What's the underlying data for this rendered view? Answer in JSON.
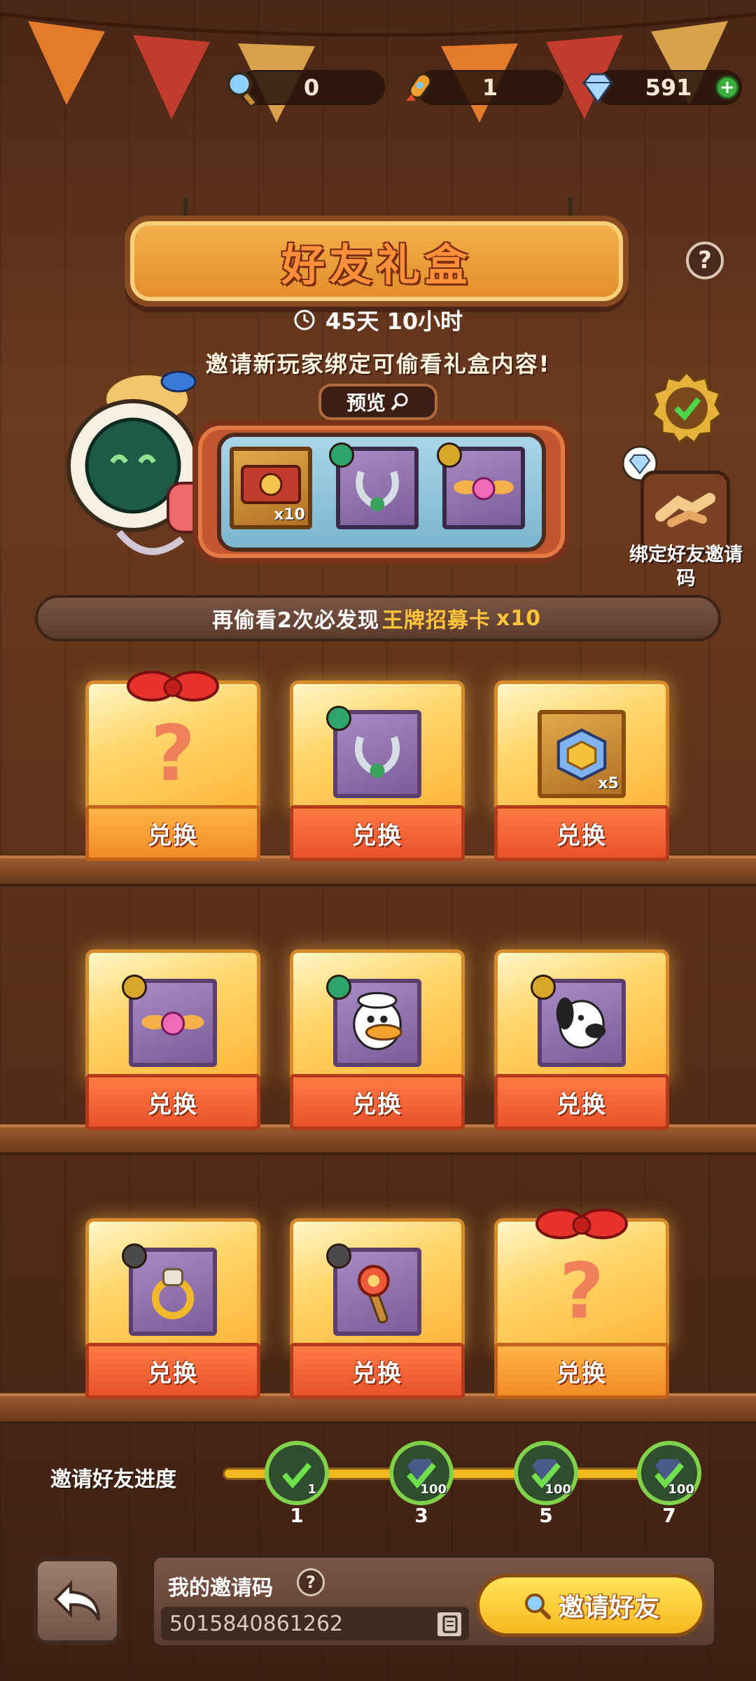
{
  "currency": [
    {
      "icon": "magnifier-icon",
      "value": "0"
    },
    {
      "icon": "rocket-icon",
      "value": "1"
    },
    {
      "icon": "diamond-icon",
      "value": "591"
    }
  ],
  "header": {
    "title": "好友礼盒",
    "timer": "45天  10小时",
    "info": "邀请新玩家绑定可偷看礼盒内容!",
    "help": "?"
  },
  "preview": {
    "label": "预览",
    "slots": [
      {
        "name": "ace-recruit-ticket",
        "qty": "x10"
      },
      {
        "name": "ring-item",
        "qty": ""
      },
      {
        "name": "winged-heart-item",
        "qty": ""
      }
    ]
  },
  "bind": {
    "label": "绑定好友邀请码"
  },
  "shelf_banner": {
    "prefix": "再偷看2次必发现",
    "highlight": "王牌招募卡",
    "suffix": "x10"
  },
  "boxes": [
    {
      "type": "mystery",
      "label": "兑换",
      "qmark": "?"
    },
    {
      "type": "item",
      "item": "ring-item",
      "label": "兑换",
      "qty": ""
    },
    {
      "type": "item",
      "item": "gold-cube-item",
      "label": "兑换",
      "qty": "x5"
    },
    {
      "type": "item",
      "item": "winged-heart-item",
      "label": "兑换",
      "qty": ""
    },
    {
      "type": "item",
      "item": "duck-character",
      "label": "兑换",
      "qty": ""
    },
    {
      "type": "item",
      "item": "dog-character",
      "label": "兑换",
      "qty": ""
    },
    {
      "type": "item",
      "item": "gold-ring-item",
      "label": "兑换",
      "qty": ""
    },
    {
      "type": "item",
      "item": "magic-wand-item",
      "label": "兑换",
      "qty": ""
    },
    {
      "type": "mystery",
      "label": "兑换",
      "qmark": "?"
    }
  ],
  "progress": {
    "label": "邀请好友进度",
    "milestones": [
      {
        "num": "1",
        "qty": "1"
      },
      {
        "num": "3",
        "qty": "100"
      },
      {
        "num": "5",
        "qty": "100"
      },
      {
        "num": "7",
        "qty": "100"
      }
    ]
  },
  "invite": {
    "code_label": "我的邀请码",
    "code_help": "?",
    "code": "5015840861262",
    "button": "邀请好友"
  },
  "colors": {
    "wood": "#5a3019",
    "glass": "#ffd66b",
    "base": "#e8522c",
    "accent": "#f3b91e",
    "badge_green": "#7fd24a"
  }
}
